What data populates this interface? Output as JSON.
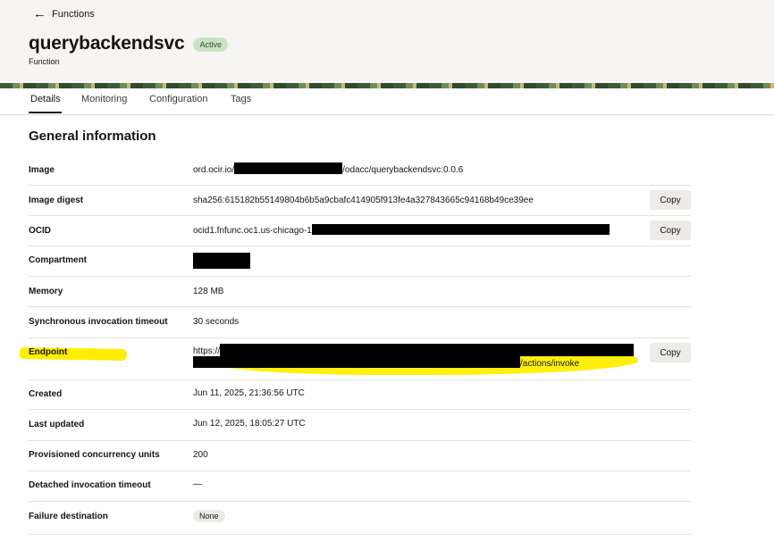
{
  "nav": {
    "back_label": "Functions"
  },
  "header": {
    "title": "querybackendsvc",
    "status": "Active",
    "subtitle": "Function"
  },
  "tabs": [
    {
      "label": "Details",
      "active": true
    },
    {
      "label": "Monitoring"
    },
    {
      "label": "Configuration"
    },
    {
      "label": "Tags"
    }
  ],
  "section": {
    "title": "General information"
  },
  "rows": {
    "image": {
      "label": "Image",
      "value_prefix": "ord.ocir.io/",
      "value_suffix": "/odacc/querybackendsvc:0.0.6"
    },
    "image_digest": {
      "label": "Image digest",
      "value": "sha256:615182b55149804b6b5a9cbafc414905f913fe4a327843665c94168b49ce39ee",
      "action": "Copy"
    },
    "ocid": {
      "label": "OCID",
      "value_prefix": "ocid1.fnfunc.oc1.us-chicago-1",
      "action": "Copy"
    },
    "compartment": {
      "label": "Compartment"
    },
    "memory": {
      "label": "Memory",
      "value": "128 MB"
    },
    "sync_timeout": {
      "label": "Synchronous invocation timeout",
      "value": "30 seconds"
    },
    "endpoint": {
      "label": "Endpoint",
      "value_prefix": "https://",
      "value_suffix": "/actions/invoke",
      "action": "Copy"
    },
    "created": {
      "label": "Created",
      "value": "Jun 11, 2025, 21:36:56 UTC"
    },
    "last_updated": {
      "label": "Last updated",
      "value": "Jun 12, 2025, 18:05:27 UTC"
    },
    "provisioned_concurrency": {
      "label": "Provisioned concurrency units",
      "value": "200"
    },
    "detached_timeout": {
      "label": "Detached invocation timeout",
      "value": "—"
    },
    "failure_destination": {
      "label": "Failure destination",
      "value": "None"
    }
  },
  "colors": {
    "highlight": "#ffee00",
    "active_badge": "#cbe3c4",
    "redaction": "#000000"
  }
}
